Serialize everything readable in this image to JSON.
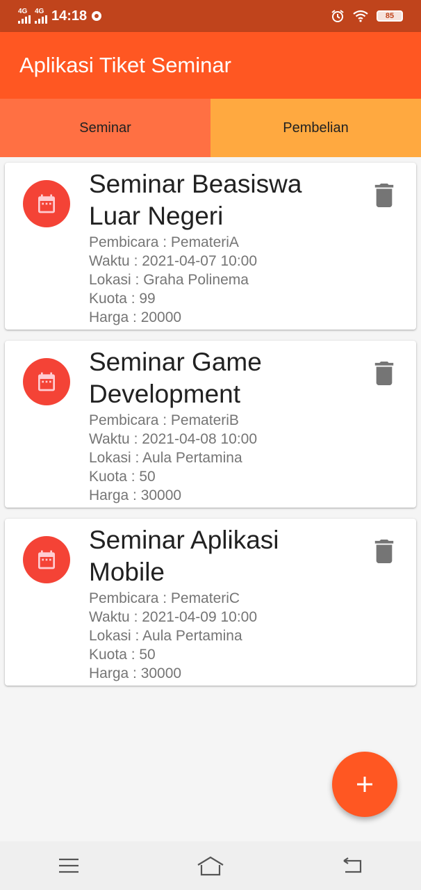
{
  "status_bar": {
    "network_1": "4G",
    "network_2": "4G",
    "time": "14:18",
    "battery": "85"
  },
  "app_bar": {
    "title": "Aplikasi Tiket Seminar"
  },
  "tabs": [
    {
      "label": "Seminar",
      "selected": true
    },
    {
      "label": "Pembelian",
      "selected": false
    }
  ],
  "seminars": [
    {
      "title": "Seminar Beasiswa Luar Negeri",
      "pembicara": "Pembicara : PemateriA",
      "waktu": "Waktu : 2021-04-07 10:00",
      "lokasi": "Lokasi : Graha Polinema",
      "kuota": "Kuota  : 99",
      "harga": "Harga  : 20000"
    },
    {
      "title": "Seminar Game Development",
      "pembicara": "Pembicara : PemateriB",
      "waktu": "Waktu : 2021-04-08 10:00",
      "lokasi": "Lokasi : Aula Pertamina",
      "kuota": "Kuota  : 50",
      "harga": "Harga  : 30000"
    },
    {
      "title": "Seminar Aplikasi Mobile",
      "pembicara": "Pembicara : PemateriC",
      "waktu": "Waktu : 2021-04-09 10:00",
      "lokasi": "Lokasi : Aula Pertamina",
      "kuota": "Kuota  : 50",
      "harga": "Harga  : 30000"
    }
  ],
  "icons": {
    "card_avatar": "calendar-icon",
    "card_action": "trash-icon",
    "fab": "plus-icon",
    "nav": [
      "menu-icon",
      "home-icon",
      "back-icon"
    ]
  },
  "colors": {
    "status_bar": "#c0441c",
    "app_bar": "#ff5722",
    "tab_seminar": "#ff7043",
    "tab_pembelian": "#ffa940",
    "avatar": "#f44336",
    "fab": "#ff5722"
  }
}
